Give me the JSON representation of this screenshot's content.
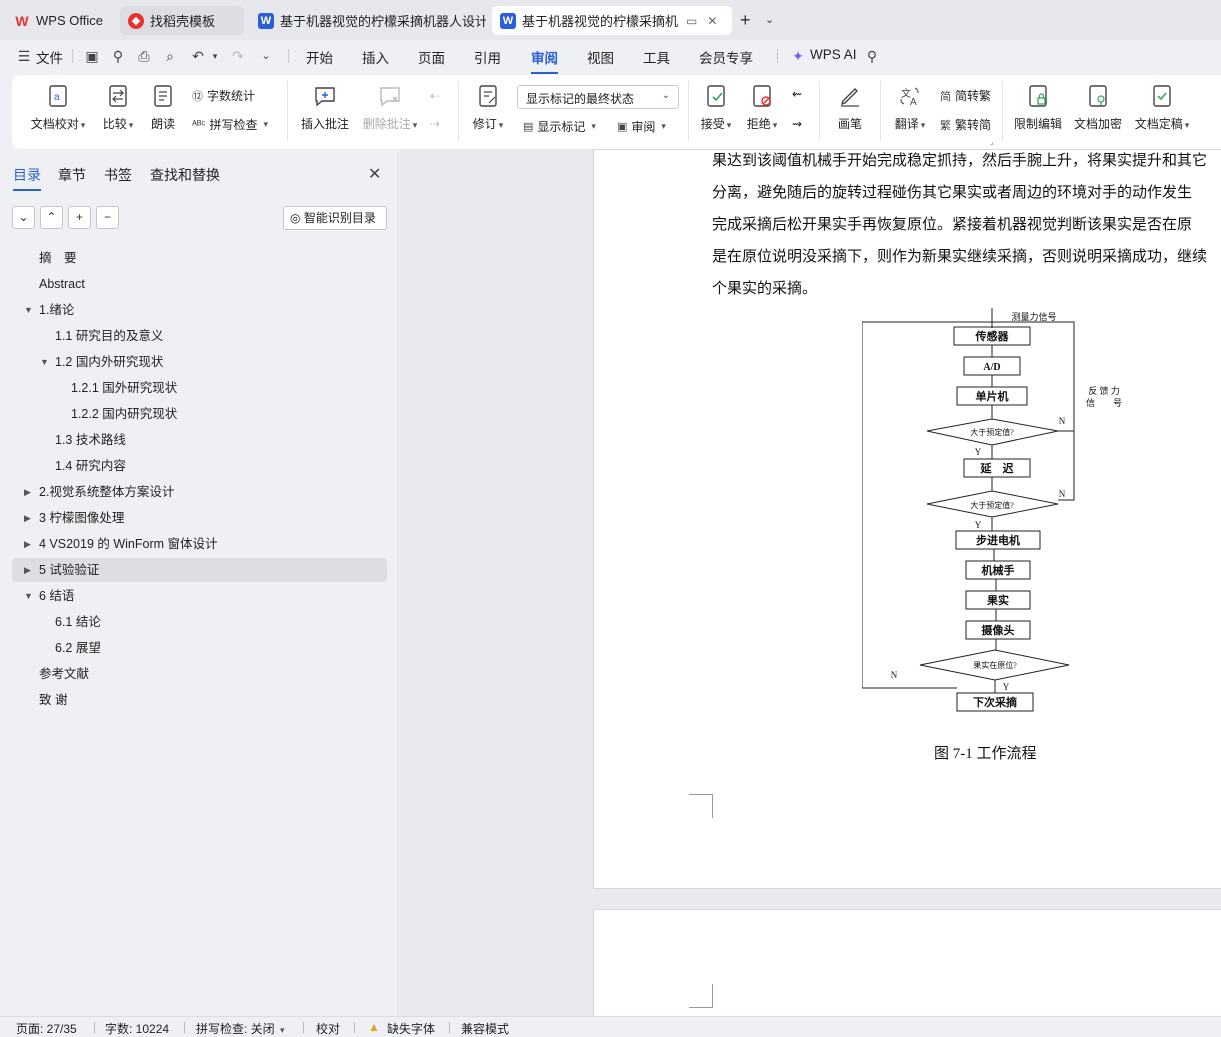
{
  "tabs": [
    {
      "label": "WPS Office",
      "icon": "wps-logo-icon",
      "color": "#e8322d"
    },
    {
      "label": "找稻壳模板",
      "icon": "daoke-logo-icon",
      "color": "#e8322d"
    },
    {
      "label": "基于机器视觉的柠檬采摘机器人设计 =",
      "icon": "word-doc-icon",
      "color": "#2b5fd9"
    },
    {
      "label": "基于机器视觉的柠檬采摘机器人",
      "icon": "word-doc-icon",
      "color": "#2b5fd9"
    }
  ],
  "menu": {
    "file": "文件",
    "items": [
      "开始",
      "插入",
      "页面",
      "引用",
      "审阅",
      "视图",
      "工具",
      "会员专享"
    ],
    "active": "审阅",
    "wps_ai": "WPS AI"
  },
  "ribbon": {
    "doc_proofread": "文档校对",
    "compare": "比较",
    "read_aloud": "朗读",
    "word_count": "字数统计",
    "spell_check": "拼写检查",
    "insert_comment": "插入批注",
    "delete_comment": "删除批注",
    "revise": "修订",
    "markup_mode": "显示标记的最终状态",
    "show_markup": "显示标记",
    "review": "审阅",
    "accept": "接受",
    "reject": "拒绝",
    "pen": "画笔",
    "translate": "翻译",
    "to_traditional": "简转繁",
    "to_simplified": "繁转简",
    "restrict_edit": "限制编辑",
    "doc_encrypt": "文档加密",
    "doc_finalize": "文档定稿"
  },
  "nav": {
    "tabs": [
      "目录",
      "章节",
      "书签",
      "查找和替换"
    ],
    "smart_toc": "智能识别目录",
    "toc": [
      {
        "label": "摘　要",
        "level": 0,
        "arrow": ""
      },
      {
        "label": "Abstract",
        "level": 0,
        "arrow": ""
      },
      {
        "label": "1.绪论",
        "level": 0,
        "arrow": "down"
      },
      {
        "label": "1.1 研究目的及意义",
        "level": 1,
        "arrow": ""
      },
      {
        "label": "1.2 国内外研究现状",
        "level": 1,
        "arrow": "down"
      },
      {
        "label": "1.2.1 国外研究现状",
        "level": 2,
        "arrow": ""
      },
      {
        "label": "1.2.2 国内研究现状",
        "level": 2,
        "arrow": ""
      },
      {
        "label": "1.3  技术路线",
        "level": 1,
        "arrow": ""
      },
      {
        "label": "1.4  研究内容",
        "level": 1,
        "arrow": ""
      },
      {
        "label": "2.视觉系统整体方案设计",
        "level": 0,
        "arrow": "right"
      },
      {
        "label": "3  柠檬图像处理",
        "level": 0,
        "arrow": "right"
      },
      {
        "label": "4 VS2019 的 WinForm 窗体设计",
        "level": 0,
        "arrow": "right"
      },
      {
        "label": "5  试验验证",
        "level": 0,
        "arrow": "right",
        "selected": true
      },
      {
        "label": "6  结语",
        "level": 0,
        "arrow": "down"
      },
      {
        "label": "6.1  结论",
        "level": 1,
        "arrow": ""
      },
      {
        "label": "6.2  展望",
        "level": 1,
        "arrow": ""
      },
      {
        "label": "参考文献",
        "level": 0,
        "arrow": ""
      },
      {
        "label": "致  谢",
        "level": 0,
        "arrow": ""
      }
    ]
  },
  "document": {
    "paragraph_lines": [
      "果达到该阈值机械手开始完成稳定抓持，然后手腕上升，将果实提升和其它",
      "分离，避免随后的旋转过程碰伤其它果实或者周边的环境对手的动作发生",
      "完成采摘后松开果实手再恢复原位。紧接着机器视觉判断该果实是否在原",
      "是在原位说明没采摘下，则作为新果实继续采摘，否则说明采摘成功，继续",
      "个果实的采摘。"
    ],
    "flowchart": {
      "input_label": "测量力信号",
      "feedback_label_1": "反 馈 力",
      "feedback_label_2": "信　　号",
      "nodes": [
        "传感器",
        "A/D",
        "单片机",
        "大于预定值?",
        "延　迟",
        "大于预定值?",
        "步进电机",
        "机械手",
        "果实",
        "摄像头",
        "果实在原位?",
        "下次采摘"
      ],
      "yes": "Y",
      "no": "N"
    },
    "caption": "图 7-1 工作流程"
  },
  "status": {
    "page": "页面: 27/35",
    "words": "字数: 10224",
    "spell": "拼写检查: 关闭",
    "proof": "校对",
    "missing_font": "缺失字体",
    "compat": "兼容模式"
  }
}
